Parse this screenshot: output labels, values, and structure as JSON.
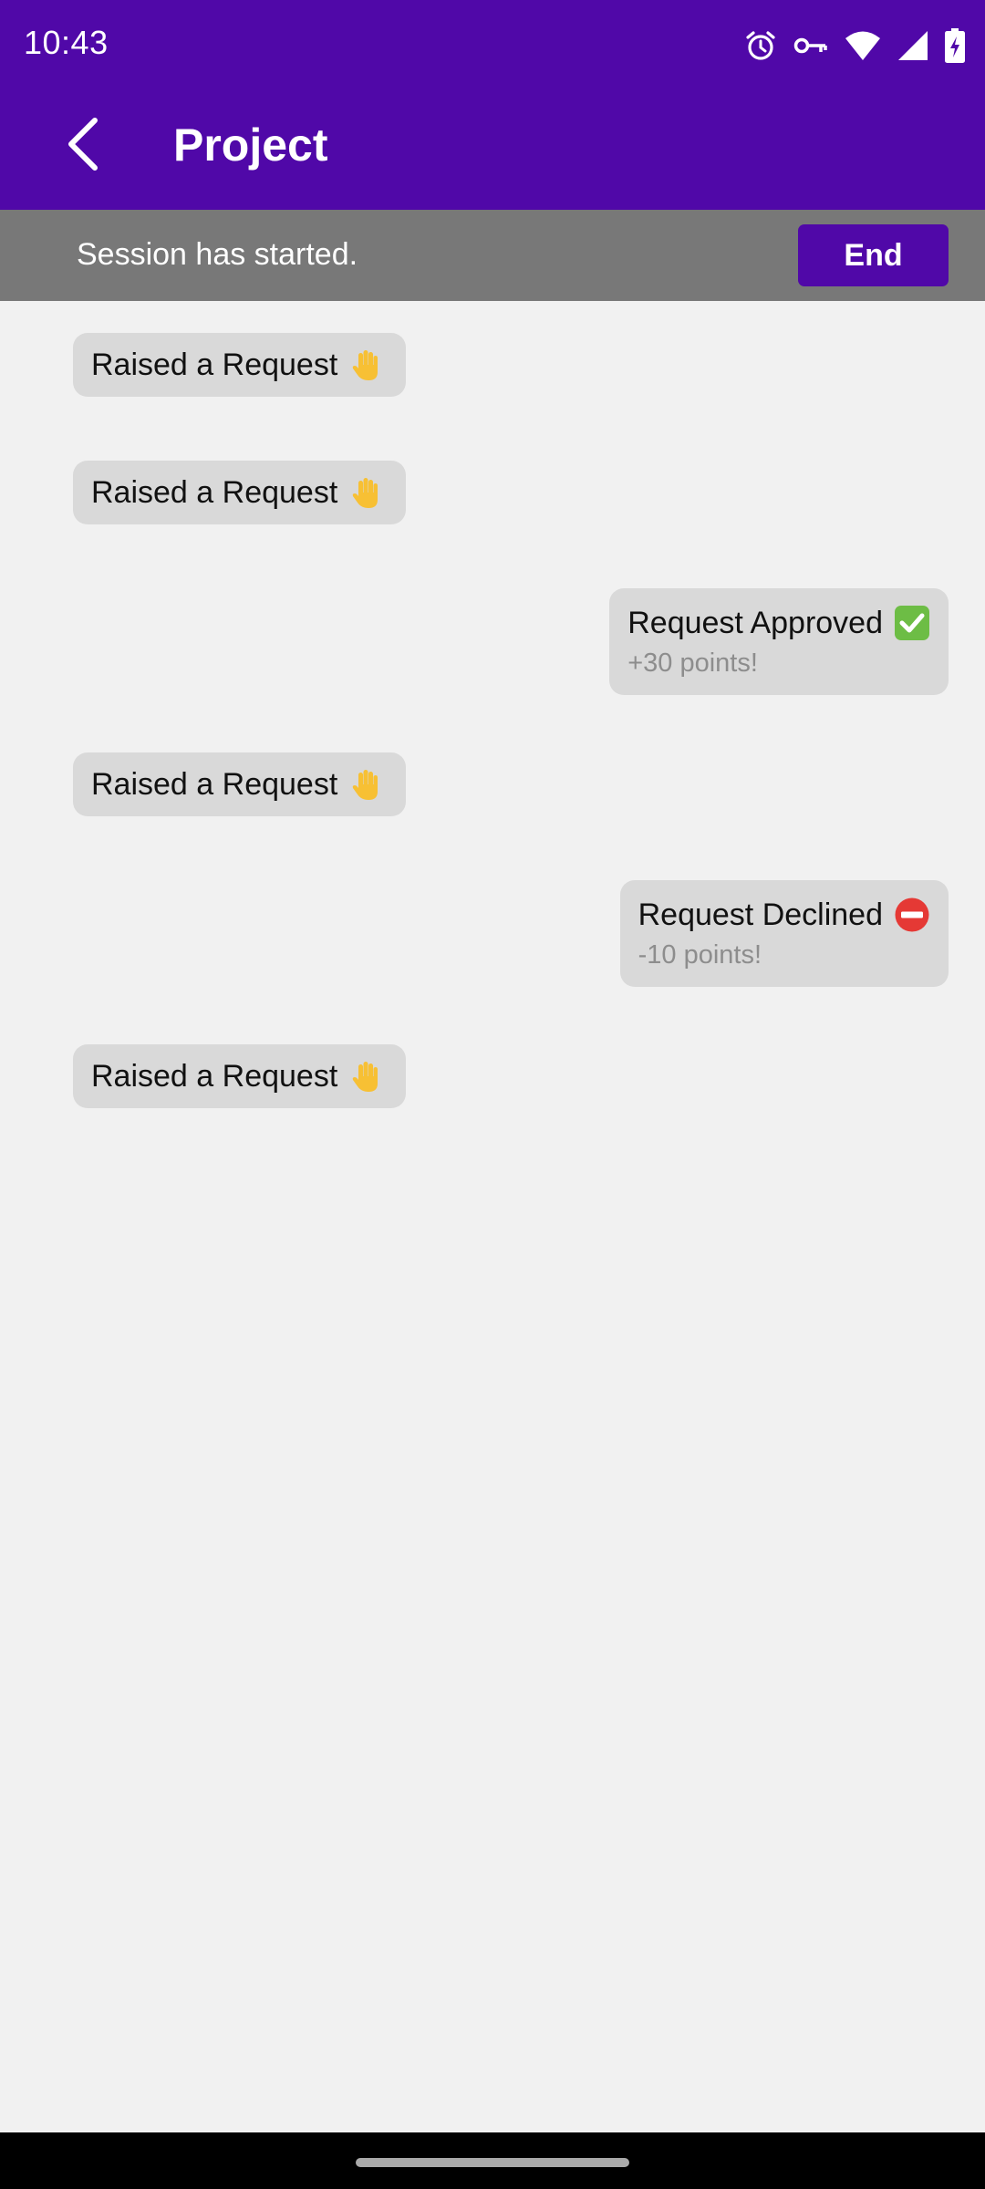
{
  "status_bar": {
    "time": "10:43",
    "icons": [
      "alarm-icon",
      "vpn-key-icon",
      "wifi-icon",
      "cell-signal-icon",
      "battery-charging-icon"
    ]
  },
  "toolbar": {
    "title": "Project",
    "back_icon": "chevron-left-icon"
  },
  "session": {
    "text": "Session has started.",
    "end_label": "End"
  },
  "messages": [
    {
      "side": "left",
      "text": "Raised a Request",
      "icon": "raised-hand-icon"
    },
    {
      "side": "left",
      "text": "Raised a Request",
      "icon": "raised-hand-icon"
    },
    {
      "side": "right",
      "text": "Request Approved",
      "icon": "check-mark-icon",
      "sub": "+30 points!"
    },
    {
      "side": "left",
      "text": "Raised a Request",
      "icon": "raised-hand-icon"
    },
    {
      "side": "right",
      "text": "Request Declined",
      "icon": "no-entry-icon",
      "sub": "-10 points!"
    },
    {
      "side": "left",
      "text": "Raised a Request",
      "icon": "raised-hand-icon"
    }
  ],
  "colors": {
    "primary": "#5008a8",
    "session_bar": "#787878",
    "background": "#f1f1f1",
    "bubble": "#d9d9d9"
  }
}
